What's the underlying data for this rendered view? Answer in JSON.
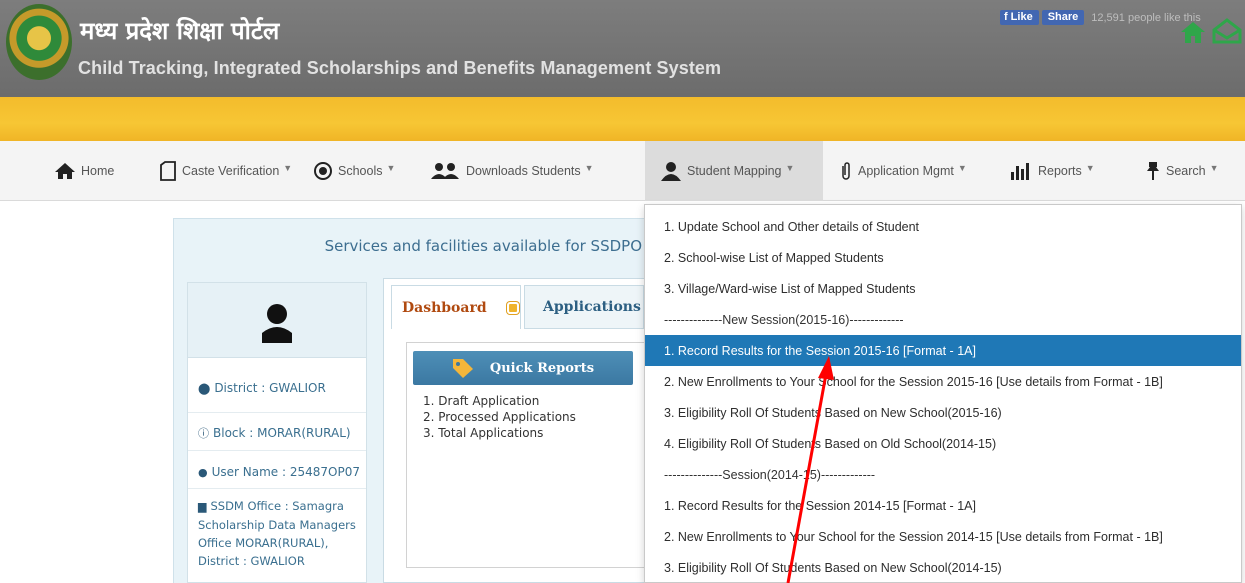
{
  "header": {
    "title": "मध्य प्रदेश शिक्षा पोर्टल",
    "subtitle": "Child Tracking, Integrated Scholarships and Benefits Management System",
    "fb_like": "Like",
    "fb_share": "Share",
    "fb_count": "12,591 people like this"
  },
  "nav": {
    "items": [
      {
        "label": "Home",
        "icon": "home-icon"
      },
      {
        "label": "Caste Verification",
        "icon": "document-icon"
      },
      {
        "label": "Schools",
        "icon": "target-icon"
      },
      {
        "label": "Downloads Students",
        "icon": "users-icon"
      },
      {
        "label": "Student Mapping",
        "icon": "user-icon"
      },
      {
        "label": "Application Mgmt",
        "icon": "paperclip-icon"
      },
      {
        "label": "Reports",
        "icon": "bar-chart-icon"
      },
      {
        "label": "Search",
        "icon": "pin-icon"
      }
    ]
  },
  "services_title": "Services and facilities available for SSDPO",
  "profile": {
    "district": "District : GWALIOR",
    "block": "Block : MORAR(RURAL)",
    "username": "User Name : 25487OP07",
    "office_line1": "SSDM Office : Samagra",
    "office_line2": "Scholarship Data Managers",
    "office_line3": "Office MORAR(RURAL),",
    "office_line4": "District : GWALIOR"
  },
  "tabs": {
    "dashboard": "Dashboard",
    "applications": "Applications"
  },
  "quick_reports": {
    "title": "Quick Reports",
    "items": [
      "1. Draft Application",
      "2. Processed Applications",
      "3. Total Applications"
    ]
  },
  "dropdown": {
    "items": [
      "1. Update School and Other details of Student",
      "2. School-wise List of Mapped Students",
      "3. Village/Ward-wise List of Mapped Students",
      "--------------New Session(2015-16)-------------",
      "1. Record Results for the Session 2015-16 [Format - 1A]",
      "2. New Enrollments to Your School for the Session 2015-16 [Use details from Format - 1B]",
      "3. Eligibility Roll Of Students Based on New School(2015-16)",
      "4. Eligibility Roll Of Students Based on Old School(2014-15)",
      "--------------Session(2014-15)-------------",
      "1. Record Results for the Session 2014-15 [Format - 1A]",
      "2. New Enrollments to Your School for the Session 2014-15 [Use details from Format - 1B]",
      "3. Eligibility Roll Of Students Based on New School(2014-15)"
    ],
    "highlighted_index": 4
  },
  "colors": {
    "header_bg": "#757575",
    "band": "#f5c030",
    "highlight": "#1f78b6",
    "arrow": "#ff0000"
  }
}
